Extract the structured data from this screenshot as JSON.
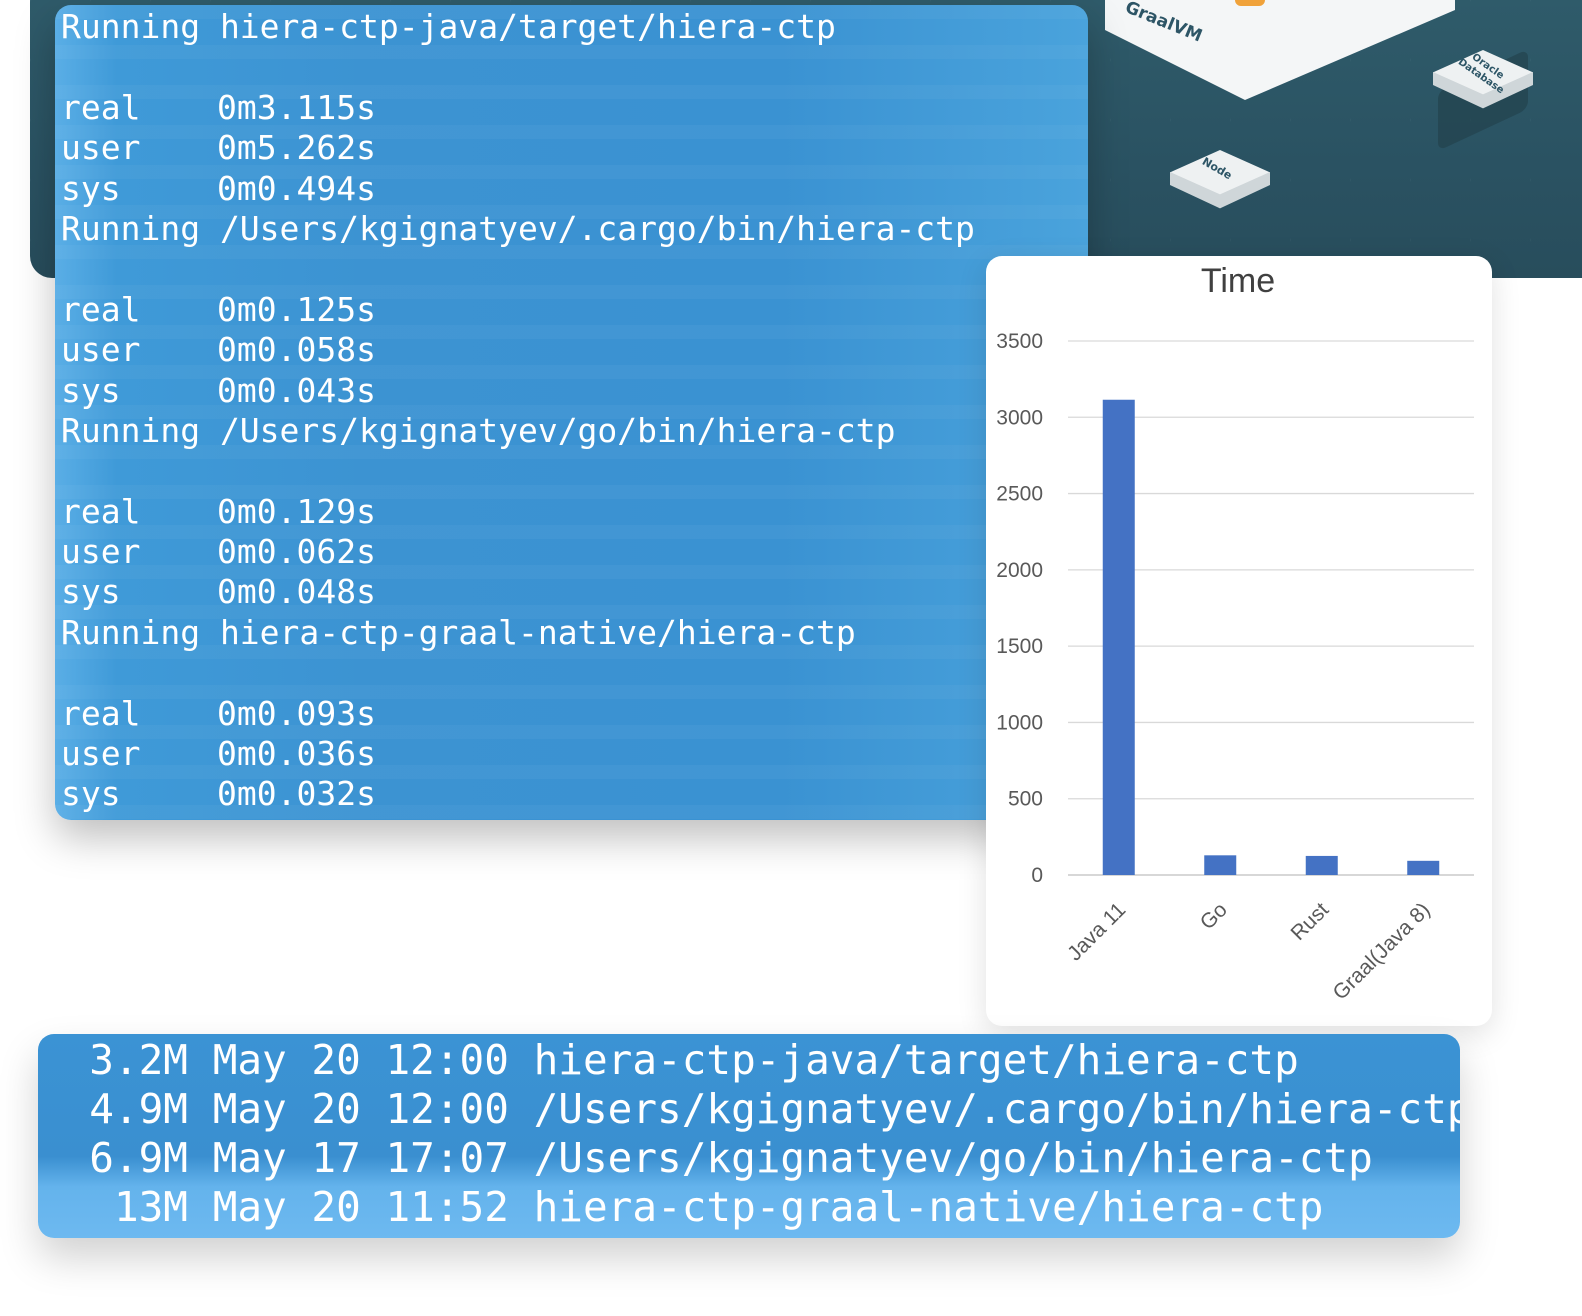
{
  "background": {
    "graalvm_label": "GraalVM",
    "oracle_label": "Oracle Database",
    "node_label": "Node"
  },
  "terminal": {
    "runs": [
      {
        "running": "Running hiera-ctp-java/target/hiera-ctp",
        "real": "0m3.115s",
        "user": "0m5.262s",
        "sys": "0m0.494s"
      },
      {
        "running": "Running /Users/kgignatyev/.cargo/bin/hiera-ctp",
        "real": "0m0.125s",
        "user": "0m0.058s",
        "sys": "0m0.043s"
      },
      {
        "running": "Running /Users/kgignatyev/go/bin/hiera-ctp",
        "real": "0m0.129s",
        "user": "0m0.062s",
        "sys": "0m0.048s"
      },
      {
        "running": "Running hiera-ctp-graal-native/hiera-ctp",
        "real": "0m0.093s",
        "user": "0m0.036s",
        "sys": "0m0.032s"
      }
    ],
    "labels": {
      "real": "real",
      "user": "user",
      "sys": "sys"
    }
  },
  "chart_data": {
    "type": "bar",
    "title": "Time",
    "categories": [
      "Java 11",
      "Go",
      "Rust",
      "Graal(Java 8)"
    ],
    "values": [
      3115,
      129,
      125,
      93
    ],
    "ylim": [
      0,
      3500
    ],
    "yticks": [
      0,
      500,
      1000,
      1500,
      2000,
      2500,
      3000,
      3500
    ],
    "grid": true,
    "bar_color": "#4472c4",
    "xlabel": "",
    "ylabel": ""
  },
  "sizes": {
    "rows": [
      {
        "size": "3.2M",
        "date": "May 20 12:00",
        "path": "hiera-ctp-java/target/hiera-ctp"
      },
      {
        "size": "4.9M",
        "date": "May 20 12:00",
        "path": "/Users/kgignatyev/.cargo/bin/hiera-ctp"
      },
      {
        "size": "6.9M",
        "date": "May 17 17:07",
        "path": "/Users/kgignatyev/go/bin/hiera-ctp"
      },
      {
        "size": "13M",
        "date": "May 20 11:52",
        "path": "hiera-ctp-graal-native/hiera-ctp"
      }
    ]
  }
}
